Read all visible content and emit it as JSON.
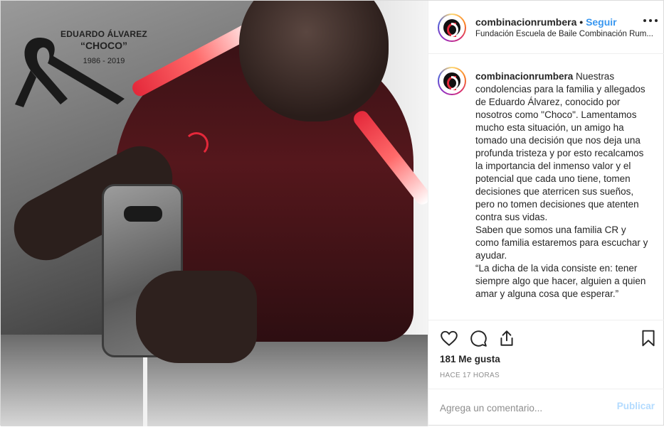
{
  "memorial": {
    "name": "EDUARDO ÁLVAREZ",
    "nickname": "“CHOCO”",
    "years": "1986 - 2019"
  },
  "header": {
    "username": "combinacionrumbera",
    "separator": "•",
    "follow_label": "Seguir",
    "subtitle": "Fundación Escuela de Baile Combinación Rum..."
  },
  "caption": {
    "username": "combinacionrumbera",
    "paragraphs": [
      "Nuestras condolencias para la familia y allegados de Eduardo Álvarez, conocido por nosotros como \"Choco\". Lamentamos mucho esta situación, un amigo ha tomado una decisión que nos deja una profunda tristeza y por esto recalcamos la importancia del inmenso valor y el potencial que cada uno tiene, tomen decisiones que aterricen sus sueños, pero no tomen decisiones que atenten contra sus vidas.",
      "Saben que somos una familia CR y como familia estaremos para escuchar y ayudar.",
      "“La dicha de la vida consiste en: tener siempre algo que hacer, alguien a quien amar y alguna cosa que esperar.”"
    ]
  },
  "actions": {
    "icons": [
      "heart-icon",
      "comment-icon",
      "share-icon",
      "bookmark-icon"
    ],
    "likes": "181 Me gusta",
    "time": "HACE 17 HORAS"
  },
  "comment_box": {
    "placeholder": "Agrega un comentario...",
    "post_label": "Publicar"
  },
  "colors": {
    "accent_blue": "#3897f0",
    "post_disabled": "#b3dbff",
    "brand_red": "#e4283a"
  }
}
